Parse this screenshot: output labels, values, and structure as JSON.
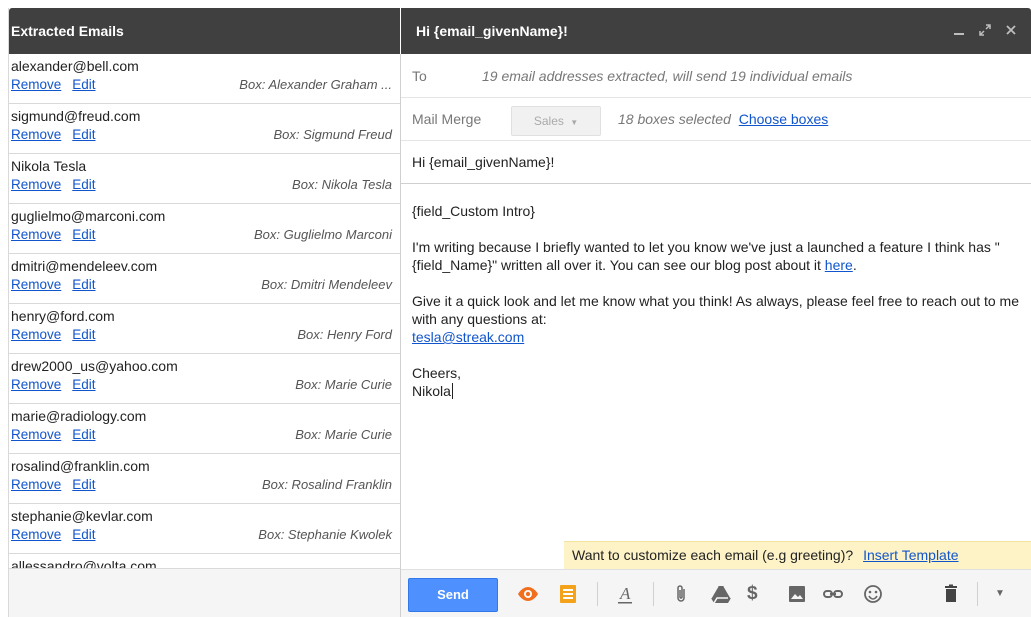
{
  "left_panel": {
    "title": "Extracted Emails",
    "remove_label": "Remove",
    "edit_label": "Edit",
    "emails": [
      {
        "address": "alexander@bell.com",
        "box": "Box: Alexander Graham ..."
      },
      {
        "address": "sigmund@freud.com",
        "box": "Box: Sigmund Freud"
      },
      {
        "address": "Nikola Tesla",
        "box": "Box: Nikola Tesla"
      },
      {
        "address": "guglielmo@marconi.com",
        "box": "Box: Guglielmo Marconi"
      },
      {
        "address": "dmitri@mendeleev.com",
        "box": "Box: Dmitri Mendeleev"
      },
      {
        "address": "henry@ford.com",
        "box": "Box: Henry Ford"
      },
      {
        "address": "drew2000_us@yahoo.com",
        "box": "Box: Marie Curie"
      },
      {
        "address": "marie@radiology.com",
        "box": "Box: Marie Curie"
      },
      {
        "address": "rosalind@franklin.com",
        "box": "Box: Rosalind Franklin"
      },
      {
        "address": "stephanie@kevlar.com",
        "box": "Box: Stephanie Kwolek"
      },
      {
        "address": "allessandro@volta.com",
        "box": ""
      }
    ]
  },
  "compose": {
    "title": "Hi {email_givenName}!",
    "window_controls": [
      "minimize-icon",
      "expand-icon",
      "close-icon"
    ],
    "to_label": "To",
    "to_text": "19 email addresses extracted, will send 19 individual emails",
    "mail_merge_label": "Mail Merge",
    "pipeline_select": "Sales",
    "boxes_selected": "18 boxes selected",
    "choose_boxes": "Choose boxes",
    "subject": "Hi {email_givenName}!",
    "body": {
      "intro": "{field_Custom Intro}",
      "para1": "I'm writing because I briefly wanted to let you know we've just a launched a feature I think has \"{field_Name}\" written all over it. You can see our blog post about it ",
      "para1_link": "here",
      "para1_end": ".",
      "para2": "Give it a quick look and let me know what you think! As always, please feel free to reach out to me with any questions at:",
      "email_link": "tesla@streak.com",
      "closing": "Cheers,",
      "signature": "Nikola"
    },
    "template_prompt": "Want to customize each email (e.g greeting)?",
    "template_link": "Insert Template",
    "send_label": "Send",
    "toolbar_icons": [
      "eye-icon",
      "snippets-icon",
      "text-format-icon",
      "attach-icon",
      "drive-icon",
      "money-icon",
      "photo-icon",
      "link-icon",
      "emoji-icon",
      "trash-icon",
      "more-options-icon"
    ]
  },
  "colors": {
    "header_bg": "#404040",
    "link": "#1155cc",
    "send_button": "#4d90fe",
    "eye_icon": "#f06e1e",
    "snippets_icon": "#f4a21a",
    "template_bar": "#fdf3c7"
  }
}
